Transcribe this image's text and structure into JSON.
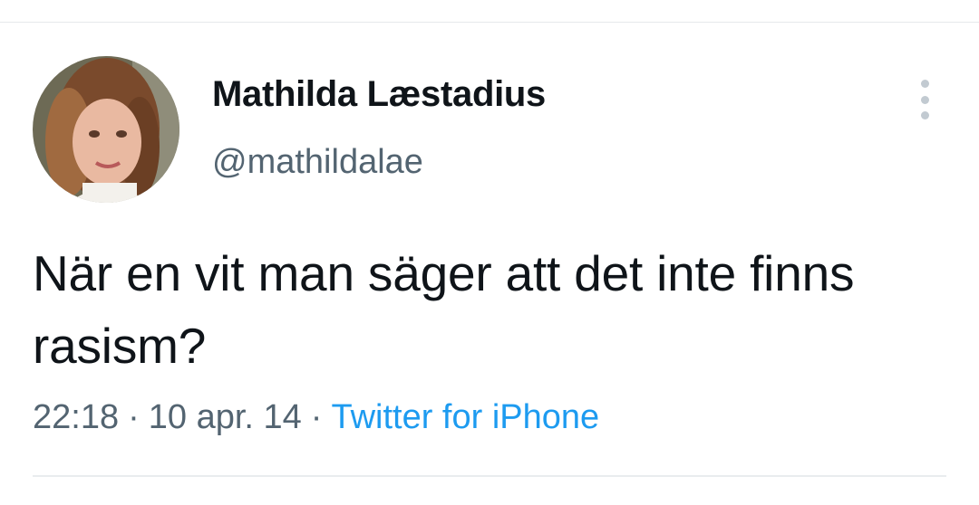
{
  "tweet": {
    "author": {
      "display_name": "Mathilda Læstadius",
      "handle": "@mathildalae",
      "avatar_icon": "profile-photo"
    },
    "text": "När en vit man säger att det inte finns rasism?",
    "time": "22:18",
    "separator": "·",
    "date": "10 apr. 14",
    "source": "Twitter for iPhone",
    "more_icon": "more-vertical-icon"
  },
  "colors": {
    "text_primary": "#0f1419",
    "text_secondary": "#536471",
    "link": "#1d9bf0",
    "divider": "#e6e9eb"
  }
}
